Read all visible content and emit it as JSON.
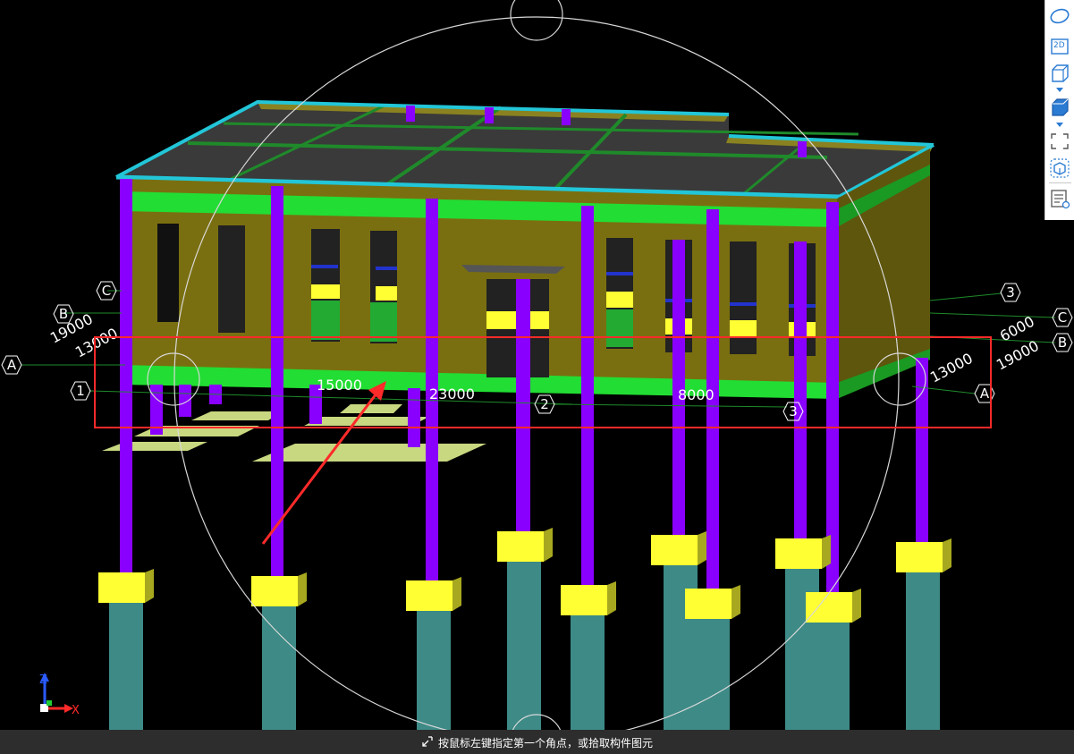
{
  "viewport": {
    "dimension_labels": {
      "dim_15000": "15000",
      "dim_23000": "23000",
      "dim_8000": "8000",
      "left_19000": "19000",
      "left_13000": "13000",
      "right_13000": "13000",
      "right_19000": "19000",
      "right_6000": "6000"
    },
    "axis_labels": {
      "left_c": "C",
      "left_b": "B",
      "left_a": "A",
      "front_1": "1",
      "front_2": "2",
      "front_3": "3",
      "right_3": "3",
      "right_c": "C",
      "right_b": "B",
      "right_a": "A"
    },
    "coord_axes": {
      "x": "X",
      "z": "Z"
    },
    "colors": {
      "column": "#8a00ff",
      "pile_cap": "#ffff33",
      "pile": "#3d8a86",
      "wall": "#7a6f10",
      "beam": "#22dd33",
      "roof_edge": "#22c6d8",
      "highlight_box": "#ff2a2a",
      "arrow": "#ff2a2a"
    }
  },
  "toolbar": {
    "items": [
      {
        "icon": "dynamic-observe-icon"
      },
      {
        "icon": "2d-view-icon",
        "label": "2D"
      },
      {
        "icon": "3d-view-icon"
      },
      {
        "icon": "3d-solid-view-icon"
      },
      {
        "icon": "full-screen-icon"
      },
      {
        "icon": "component-display-icon"
      },
      {
        "icon": "property-display-icon"
      }
    ]
  },
  "statusbar": {
    "icon": "pick-corner-icon",
    "text": "按鼠标左键指定第一个角点，或拾取构件图元"
  }
}
